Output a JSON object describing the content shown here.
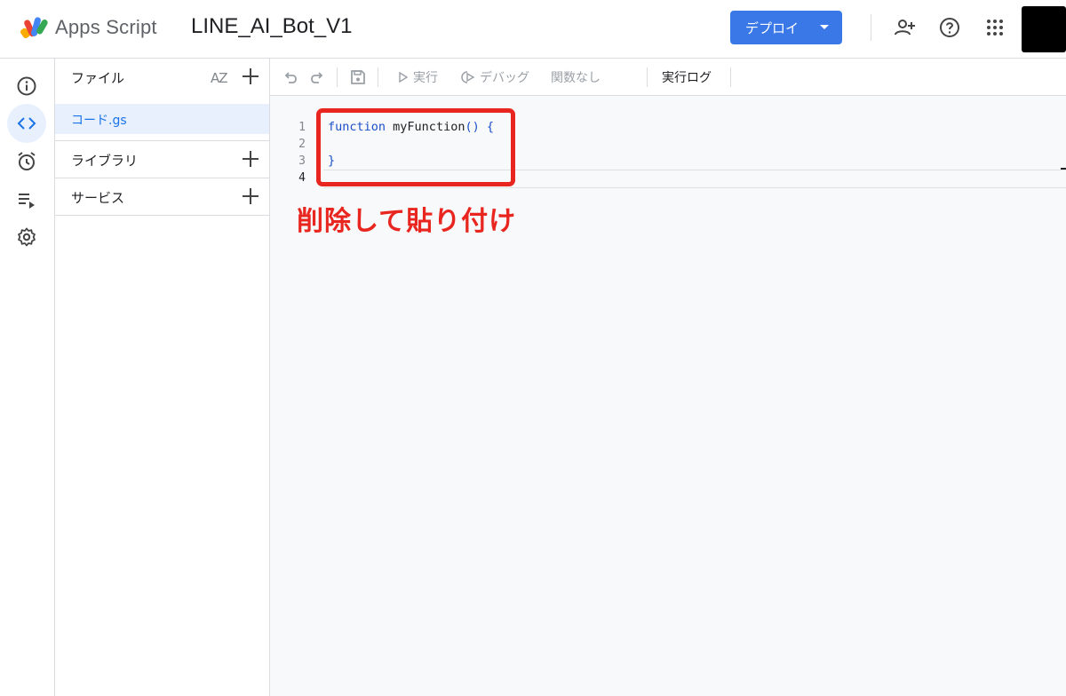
{
  "header": {
    "app_name": "Apps Script",
    "project_name": "LINE_AI_Bot_V1",
    "deploy_label": "デプロイ"
  },
  "header_icons": [
    "add-person-icon",
    "help-icon",
    "apps-grid-icon"
  ],
  "rail": {
    "items": [
      {
        "name": "overview",
        "icon": "info-icon"
      },
      {
        "name": "editor",
        "icon": "code-icon",
        "active": true
      },
      {
        "name": "triggers",
        "icon": "alarm-clock-icon"
      },
      {
        "name": "executions",
        "icon": "list-play-icon"
      },
      {
        "name": "settings",
        "icon": "gear-icon"
      }
    ]
  },
  "files_panel": {
    "files_label": "ファイル",
    "sort_label": "AZ",
    "file_name": "コード.gs",
    "libraries_label": "ライブラリ",
    "services_label": "サービス"
  },
  "toolbar": {
    "run_label": "実行",
    "debug_label": "デバッグ",
    "function_label": "関数なし",
    "log_label": "実行ログ"
  },
  "code": {
    "line_numbers": [
      "1",
      "2",
      "3",
      "4"
    ],
    "line1_keyword": "function",
    "line1_name": "myFunction",
    "line1_parens": "()",
    "line1_brace": "{",
    "line3_brace": "}"
  },
  "annotation": {
    "text": "削除して貼り付け",
    "color": "#e8261f"
  },
  "colors": {
    "accent": "#3b78e7",
    "selection": "#e8f0fe",
    "link": "#1a73e8"
  }
}
